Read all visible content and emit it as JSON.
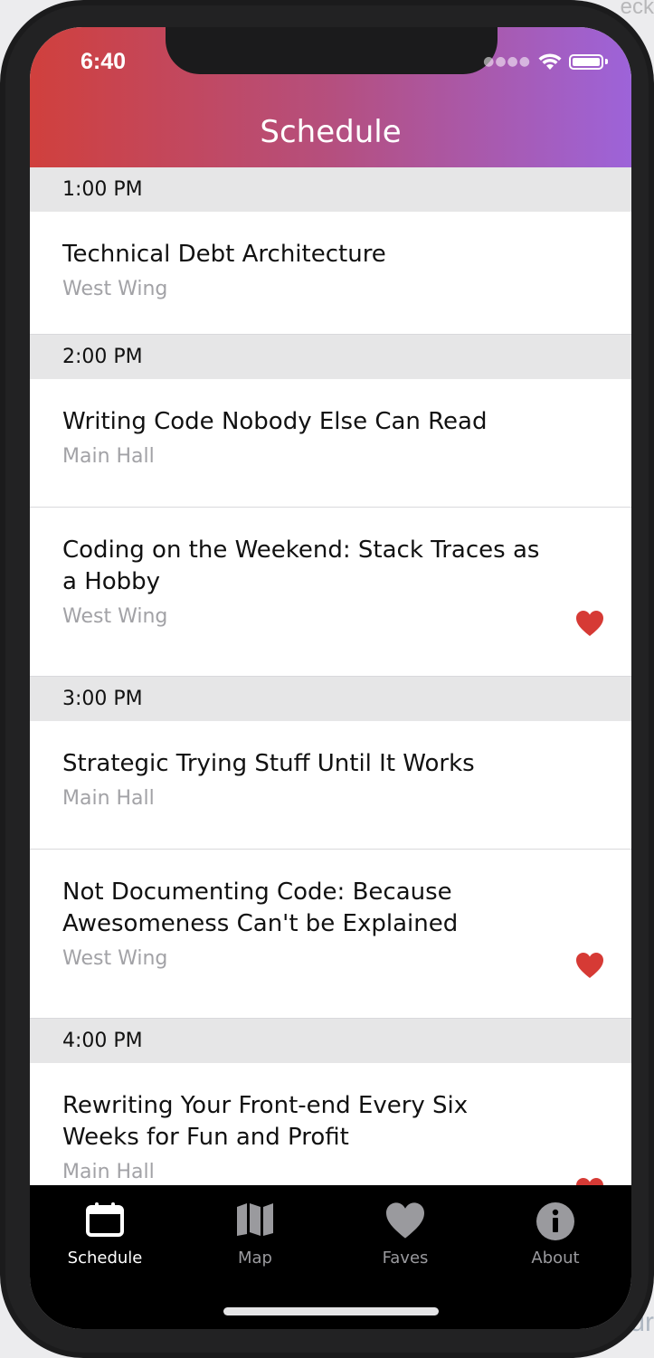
{
  "status_bar": {
    "time": "6:40"
  },
  "header": {
    "title": "Schedule"
  },
  "colors": {
    "gradient_start": "#d0403d",
    "gradient_end": "#9d63d9",
    "heart": "#d63a35",
    "tab_active": "#ffffff",
    "tab_inactive": "#9a9a9e"
  },
  "corner": {
    "top_right": "eck",
    "bottom_right": "ur"
  },
  "schedule": [
    {
      "time": "1:00 PM",
      "sessions": [
        {
          "title": "Technical Debt Architecture",
          "room": "West Wing",
          "favorite": false
        }
      ]
    },
    {
      "time": "2:00 PM",
      "sessions": [
        {
          "title": "Writing Code Nobody Else Can Read",
          "room": "Main Hall",
          "favorite": false
        },
        {
          "title": "Coding on the Weekend: Stack Traces as a Hobby",
          "room": "West Wing",
          "favorite": true
        }
      ]
    },
    {
      "time": "3:00 PM",
      "sessions": [
        {
          "title": "Strategic Trying Stuff Until It Works",
          "room": "Main Hall",
          "favorite": false
        },
        {
          "title": "Not Documenting Code: Because Awesomeness Can't be Explained",
          "room": "West Wing",
          "favorite": true
        }
      ]
    },
    {
      "time": "4:00 PM",
      "sessions": [
        {
          "title": "Rewriting Your Front-end Every Six Weeks for Fun and Profit",
          "room": "Main Hall",
          "favorite": true
        }
      ]
    }
  ],
  "tabs": [
    {
      "label": "Schedule",
      "icon": "calendar-icon",
      "active": true
    },
    {
      "label": "Map",
      "icon": "map-icon",
      "active": false
    },
    {
      "label": "Faves",
      "icon": "heart-icon",
      "active": false
    },
    {
      "label": "About",
      "icon": "info-icon",
      "active": false
    }
  ]
}
